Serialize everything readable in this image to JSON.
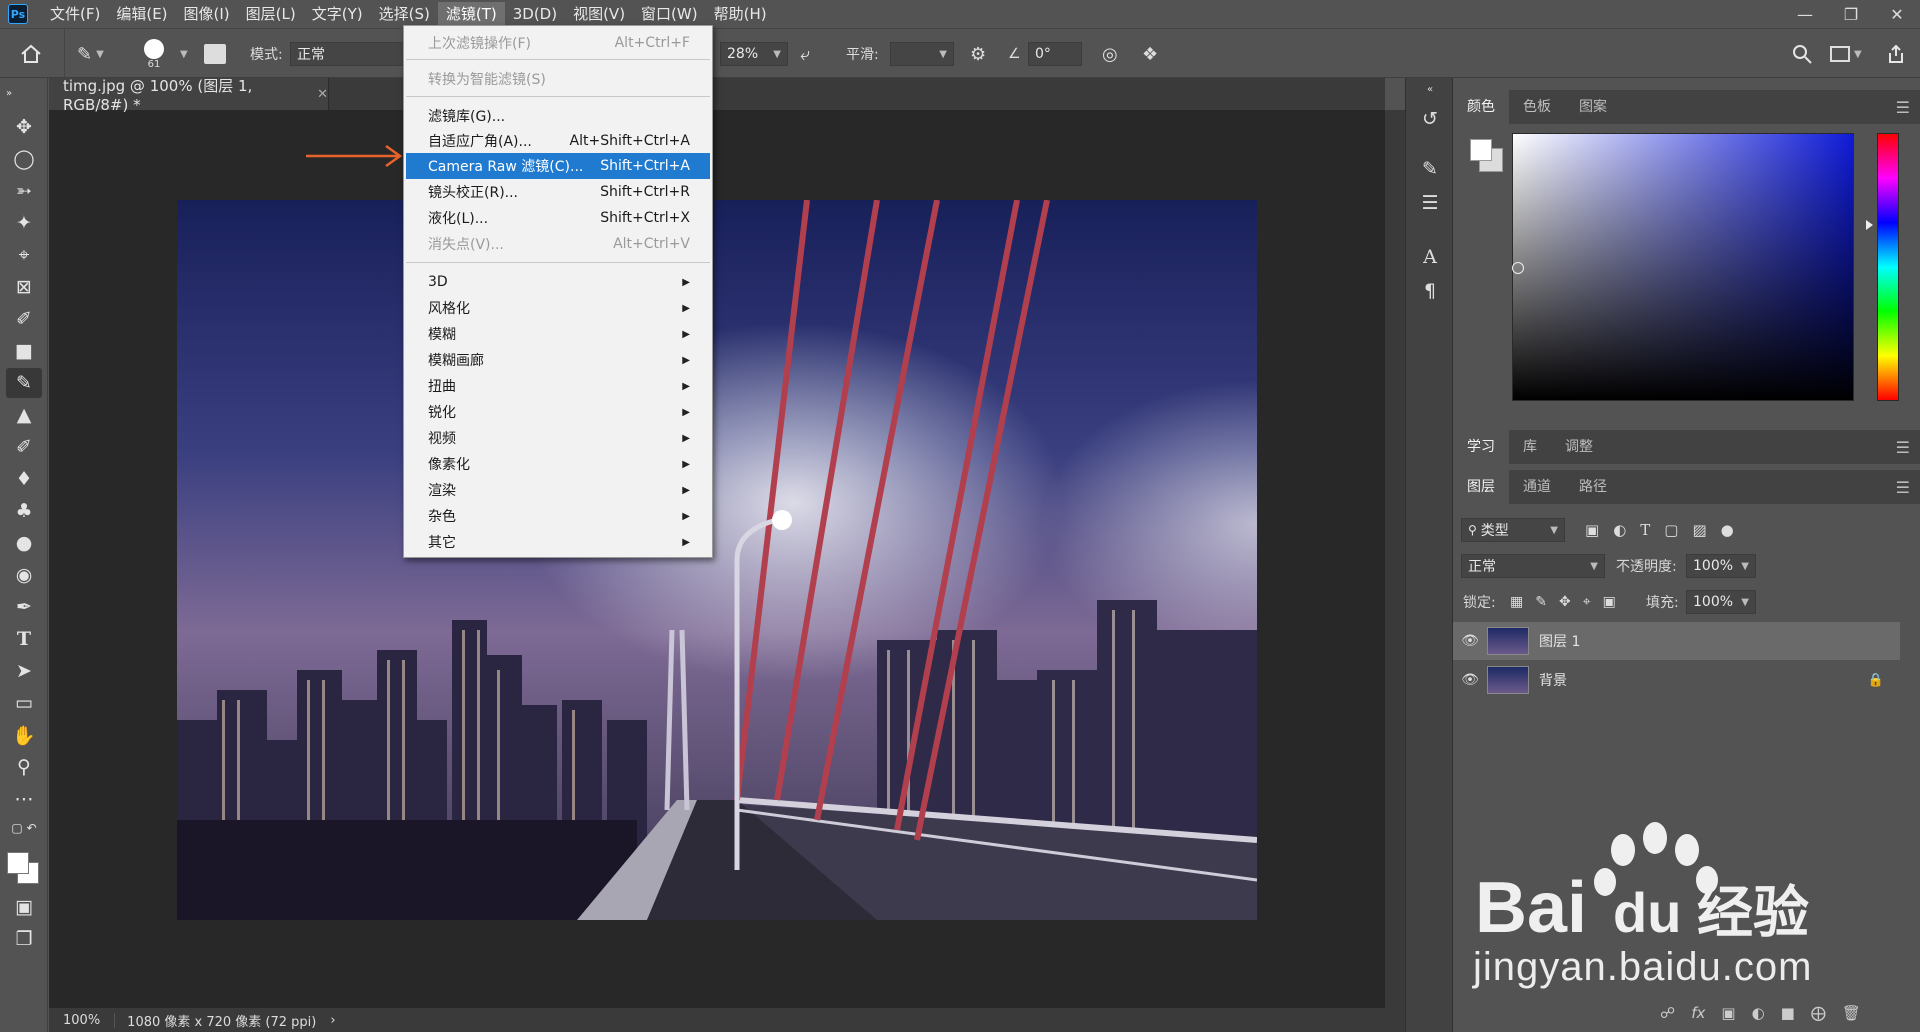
{
  "app": {
    "logo": "Ps"
  },
  "menubar": {
    "items": [
      "文件(F)",
      "编辑(E)",
      "图像(I)",
      "图层(L)",
      "文字(Y)",
      "选择(S)",
      "滤镜(T)",
      "3D(D)",
      "视图(V)",
      "窗口(W)",
      "帮助(H)"
    ],
    "active_index": 6,
    "window_controls": [
      "minimize-icon",
      "restore-icon",
      "close-icon"
    ]
  },
  "options": {
    "brush_size": "61",
    "mode_label": "模式:",
    "mode_value": "正常",
    "flow_value": "28%",
    "smoothing_label": "平滑:",
    "angle_value": "0°"
  },
  "document": {
    "tab_title": "timg.jpg @ 100% (图层 1, RGB/8#) *",
    "zoom": "100%",
    "info": "1080 像素 x 720 像素 (72 ppi)"
  },
  "filter_menu": {
    "items": [
      {
        "label": "上次滤镜操作(F)",
        "shortcut": "Alt+Ctrl+F",
        "disabled": true
      },
      {
        "label": "转换为智能滤镜(S)",
        "shortcut": "",
        "disabled": true
      },
      {
        "label": "滤镜库(G)...",
        "shortcut": ""
      },
      {
        "label": "自适应广角(A)...",
        "shortcut": "Alt+Shift+Ctrl+A"
      },
      {
        "label": "Camera Raw 滤镜(C)...",
        "shortcut": "Shift+Ctrl+A",
        "highlighted": true
      },
      {
        "label": "镜头校正(R)...",
        "shortcut": "Shift+Ctrl+R"
      },
      {
        "label": "液化(L)...",
        "shortcut": "Shift+Ctrl+X"
      },
      {
        "label": "消失点(V)...",
        "shortcut": "Alt+Ctrl+V",
        "disabled": true
      },
      {
        "label": "3D",
        "submenu": true
      },
      {
        "label": "风格化",
        "submenu": true
      },
      {
        "label": "模糊",
        "submenu": true
      },
      {
        "label": "模糊画廊",
        "submenu": true
      },
      {
        "label": "扭曲",
        "submenu": true
      },
      {
        "label": "锐化",
        "submenu": true
      },
      {
        "label": "视频",
        "submenu": true
      },
      {
        "label": "像素化",
        "submenu": true
      },
      {
        "label": "渲染",
        "submenu": true
      },
      {
        "label": "杂色",
        "submenu": true
      },
      {
        "label": "其它",
        "submenu": true
      }
    ]
  },
  "color_panel": {
    "tabs": [
      "颜色",
      "色板",
      "图案"
    ],
    "active_tab": 0,
    "hue_color": "#0f1bd8"
  },
  "learn_panel": {
    "tabs": [
      "学习",
      "库",
      "调整"
    ],
    "active_tab": 0
  },
  "layers_panel": {
    "tabs": [
      "图层",
      "通道",
      "路径"
    ],
    "active_tab": 0,
    "filter_label": "类型",
    "blend_mode": "正常",
    "opacity_label": "不透明度:",
    "opacity_value": "100%",
    "lock_label": "锁定:",
    "fill_label": "填充:",
    "fill_value": "100%",
    "layers": [
      {
        "name": "图层 1",
        "selected": true,
        "locked": false
      },
      {
        "name": "背景",
        "selected": false,
        "locked": true
      }
    ]
  },
  "watermark": {
    "url": "jingyan.baidu.com",
    "logo_text": "Bai",
    "logo_text2": "du",
    "logo_text3": "经验"
  },
  "colors": {
    "accent": "#1f7ad0",
    "annotation": "#e8622c"
  }
}
